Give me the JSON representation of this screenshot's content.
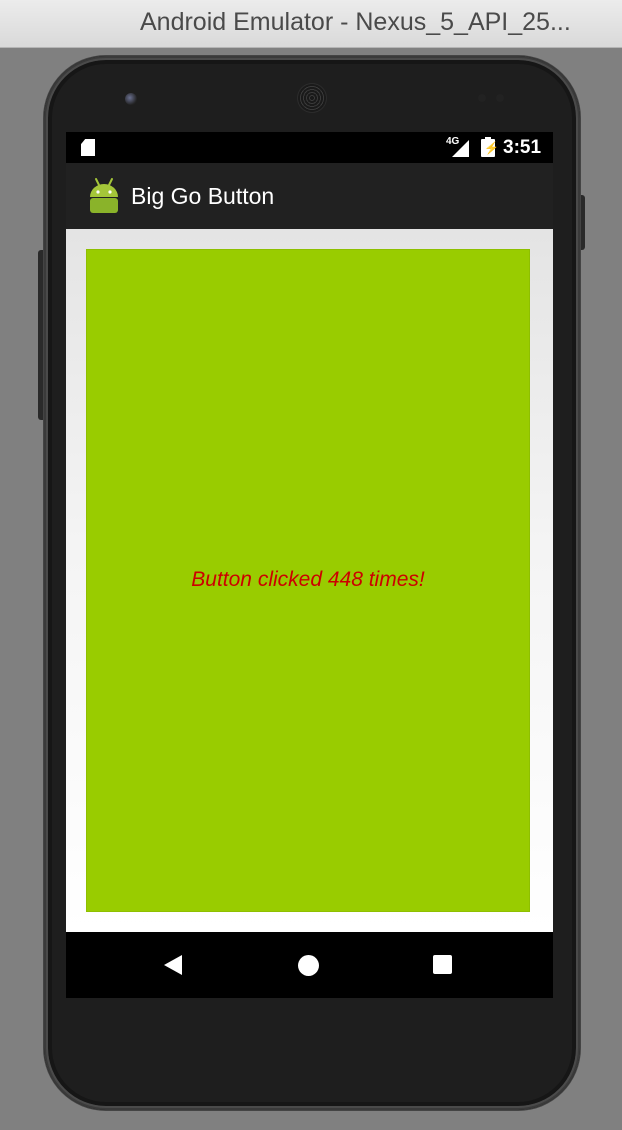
{
  "window": {
    "title": "Android Emulator - Nexus_5_API_25..."
  },
  "status_bar": {
    "network": "4G",
    "time": "3:51"
  },
  "app_bar": {
    "title": "Big Go Button"
  },
  "main": {
    "button_label": "Button clicked 448 times!",
    "button_color": "#99cc00",
    "label_color": "#cc0000"
  },
  "nav_bar": {
    "back_icon": "back-icon",
    "home_icon": "home-icon",
    "recents_icon": "recents-icon"
  }
}
